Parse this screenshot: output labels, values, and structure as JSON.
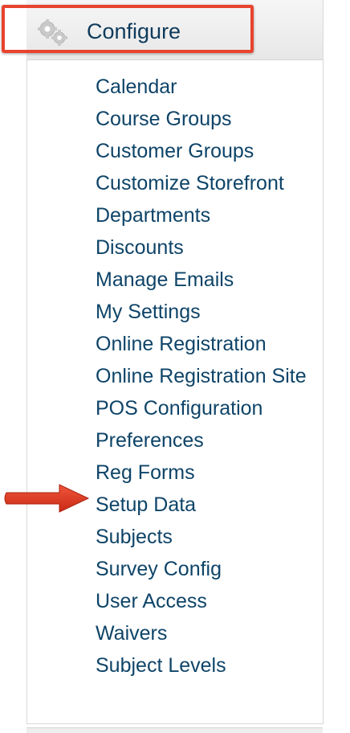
{
  "header": {
    "title": "Configure",
    "icon": "gears-icon"
  },
  "menu": {
    "items": [
      {
        "label": "Calendar"
      },
      {
        "label": "Course Groups"
      },
      {
        "label": "Customer Groups"
      },
      {
        "label": "Customize Storefront"
      },
      {
        "label": "Departments"
      },
      {
        "label": "Discounts"
      },
      {
        "label": "Manage Emails"
      },
      {
        "label": "My Settings"
      },
      {
        "label": "Online Registration"
      },
      {
        "label": "Online Registration Site"
      },
      {
        "label": "POS Configuration"
      },
      {
        "label": "Preferences"
      },
      {
        "label": "Reg Forms"
      },
      {
        "label": "Setup Data"
      },
      {
        "label": "Subjects"
      },
      {
        "label": "Survey Config"
      },
      {
        "label": "User Access"
      },
      {
        "label": "Waivers"
      },
      {
        "label": "Subject Levels"
      }
    ]
  },
  "annotations": {
    "highlight_color": "#e8432e",
    "arrow_color": "#e23a22",
    "arrow_target": "Reg Forms"
  },
  "colors": {
    "link": "#0e4468",
    "header_text": "#0e3a5b"
  }
}
